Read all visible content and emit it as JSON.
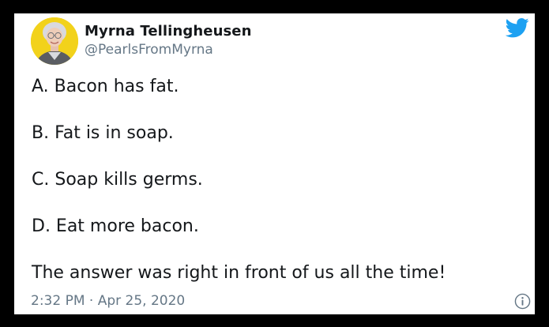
{
  "author": {
    "name": "Myrna Tellingheusen",
    "handle": "@PearlsFromMyrna",
    "avatar_icon": "profile-photo"
  },
  "tweet": {
    "lines": [
      "A.  Bacon has fat.",
      "B.  Fat is in soap.",
      "C.  Soap kills germs.",
      "D.  Eat more bacon.",
      "The answer was right in front of us all the time!"
    ],
    "time": "2:32 PM",
    "separator": " · ",
    "date": "Apr 25, 2020"
  },
  "icons": {
    "brand": "twitter-bird-icon",
    "info": "info-icon"
  },
  "colors": {
    "brand": "#1da1f2",
    "text": "#14171a",
    "secondary": "#657786",
    "background": "#ffffff",
    "frame": "#000000"
  }
}
